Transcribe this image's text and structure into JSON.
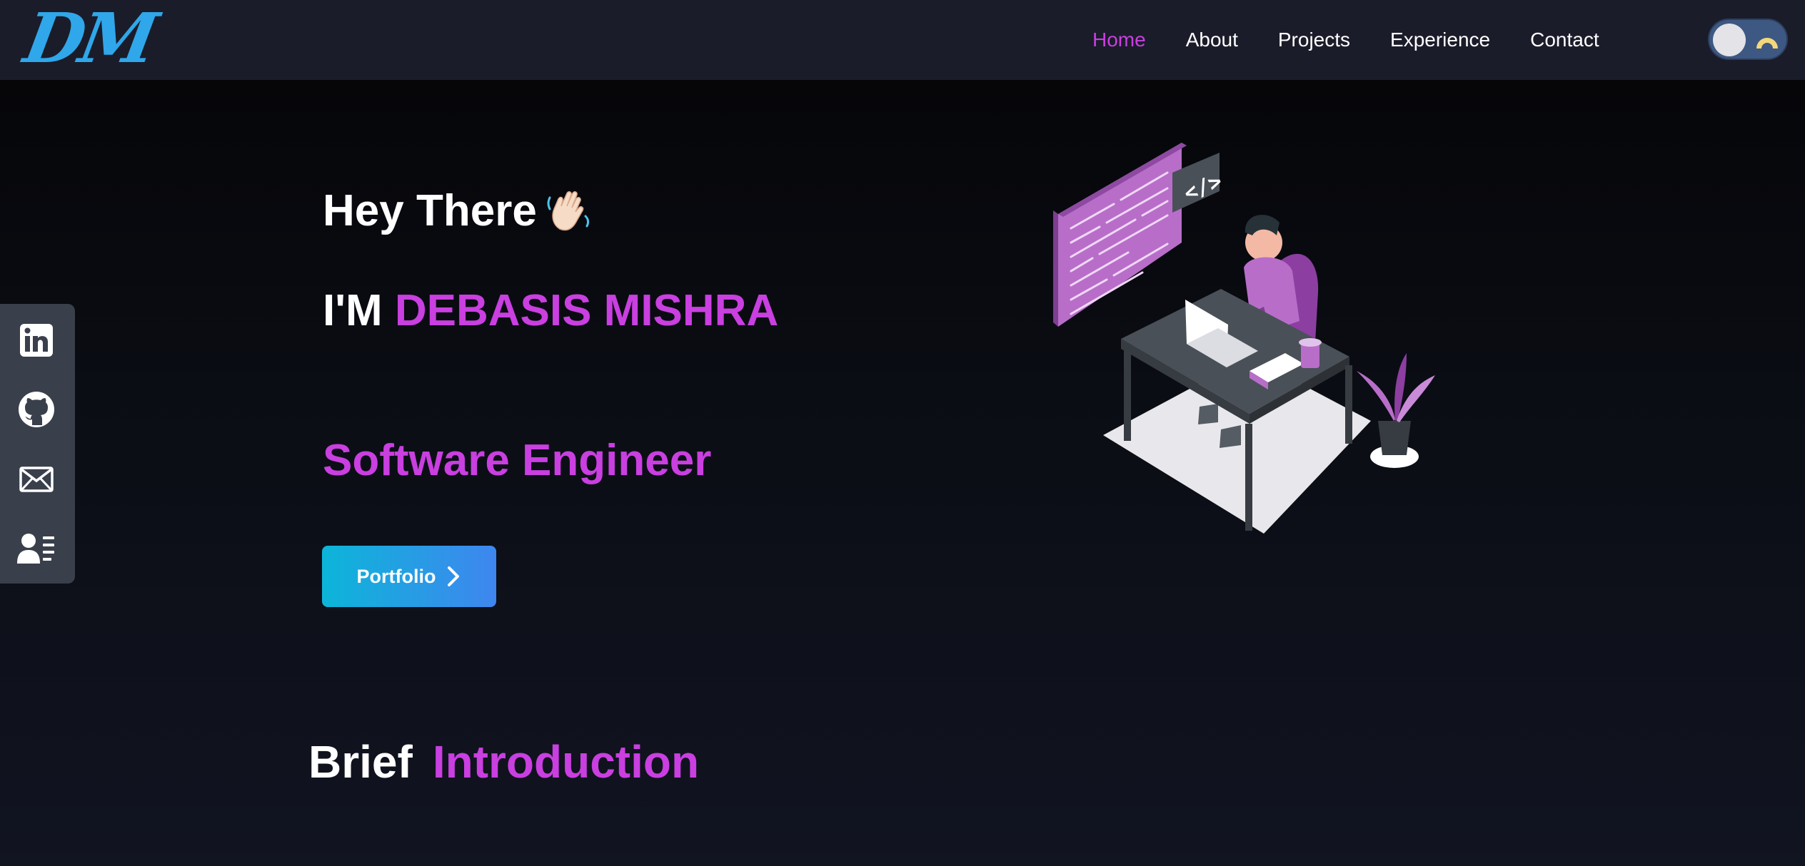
{
  "logo": {
    "text": "DM"
  },
  "nav": {
    "links": [
      {
        "label": "Home",
        "active": true
      },
      {
        "label": "About",
        "active": false
      },
      {
        "label": "Projects",
        "active": false
      },
      {
        "label": "Experience",
        "active": false
      },
      {
        "label": "Contact",
        "active": false
      }
    ],
    "theme_toggle": {
      "mode": "dark",
      "icon": "moon-icon"
    }
  },
  "social": {
    "items": [
      {
        "name": "linkedin-icon"
      },
      {
        "name": "github-icon"
      },
      {
        "name": "mail-icon"
      },
      {
        "name": "contact-card-icon"
      }
    ]
  },
  "hero": {
    "greeting": "Hey There",
    "greeting_icon": "waving-hand-icon",
    "name_prefix": "I'M ",
    "name": "DEBASIS MISHRA",
    "role": "Software Engineer",
    "button_label": "Portfolio",
    "illustration": "developer-at-desk-illustration"
  },
  "section": {
    "title_word1": "Brief",
    "title_word2": "Introduction"
  },
  "colors": {
    "accent": "#c93fe0",
    "logo": "#2fa7ea",
    "navbar": "#1a1c2a",
    "button_start": "#0cb5d9",
    "button_end": "#3f86ef"
  }
}
